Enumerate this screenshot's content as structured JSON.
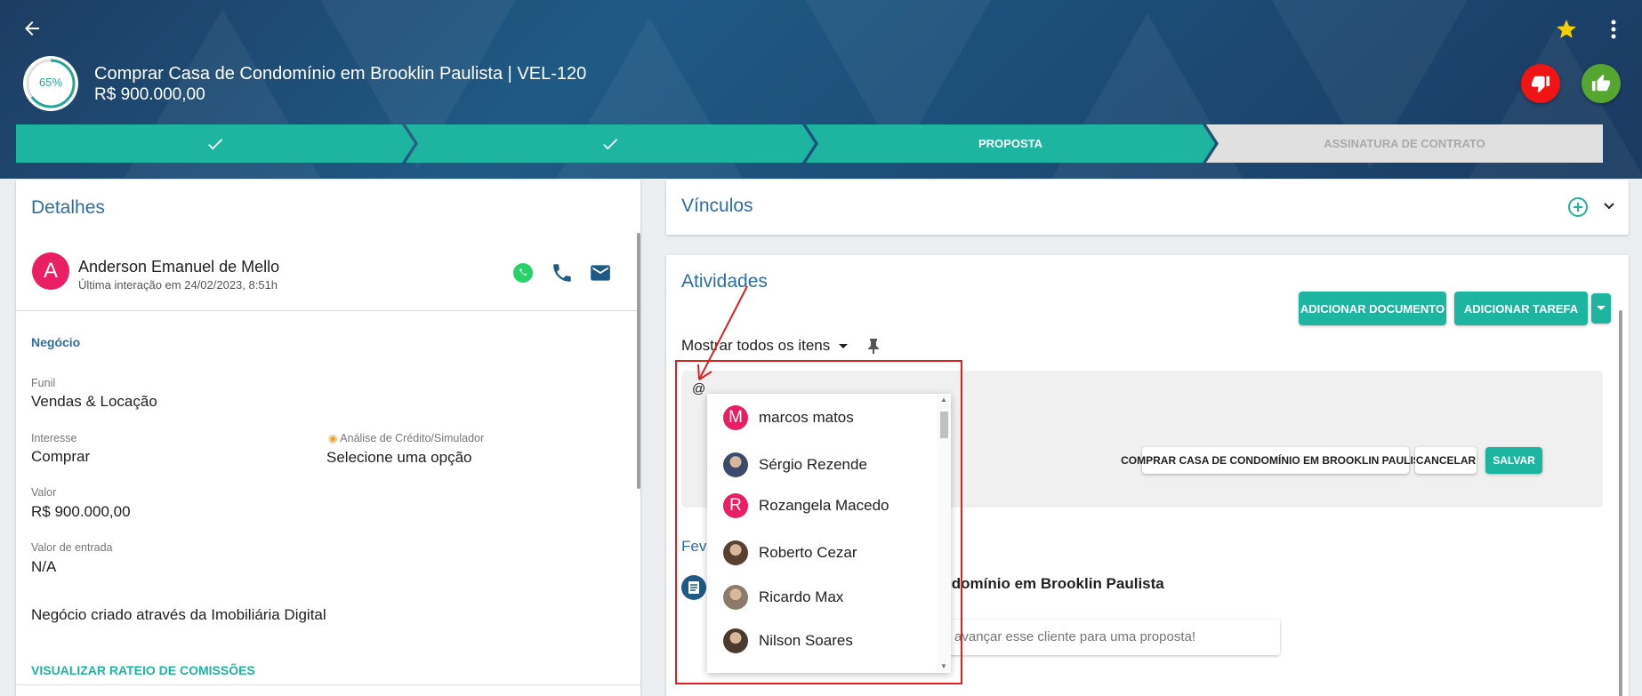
{
  "header": {
    "progress_label": "65%",
    "progress_value": 0.65,
    "deal_title": "Comprar Casa de Condomínio em Brooklin Paulista | VEL-120",
    "deal_value": "R$ 900.000,00",
    "favorite_icon": "star-icon",
    "more_icon": "more-vert-icon",
    "back_icon": "arrow-back-icon",
    "lose_icon": "thumb-down-icon",
    "win_icon": "thumb-up-icon",
    "colors": {
      "lose": "#f01414",
      "win": "#55a630",
      "accent": "#1db5a0"
    }
  },
  "stages": [
    {
      "label": "",
      "status": "done",
      "icon": "check-icon"
    },
    {
      "label": "",
      "status": "done",
      "icon": "check-icon"
    },
    {
      "label": "PROPOSTA",
      "status": "current"
    },
    {
      "label": "ASSINATURA DE CONTRATO",
      "status": "future"
    }
  ],
  "details": {
    "title": "Detalhes",
    "contact": {
      "initial": "A",
      "name": "Anderson Emanuel de Mello",
      "last_interaction": "Última interação em 24/02/2023, 8:51h"
    },
    "section": "Negócio",
    "funil_label": "Funil",
    "funil_value": "Vendas & Locação",
    "interesse_label": "Interesse",
    "interesse_value": "Comprar",
    "credito_label": "Análise de Crédito/Simulador",
    "credito_value": "Selecione uma opção",
    "valor_label": "Valor",
    "valor_value": "R$ 900.000,00",
    "entrada_label": "Valor de entrada",
    "entrada_value": "N/A",
    "origin_text": "Negócio criado através da Imobiliária Digital",
    "commission_link": "VISUALIZAR RATEIO DE COMISSÕES"
  },
  "vinculos": {
    "title": "Vínculos"
  },
  "atividades": {
    "title": "Atividades",
    "add_document": "ADICIONAR DOCUMENTO",
    "add_task": "ADICIONAR TAREFA",
    "filter": "Mostrar todos os itens",
    "editor_text": "@",
    "deal_chip": "COMPRAR CASA DE CONDOMÍNIO EM BROOKLIN PAULISTA",
    "cancel": "CANCELAR",
    "save": "SALVAR",
    "feed_date": "Fev",
    "feed_title": "ondomínio em Brooklin Paulista",
    "feed_message": "os avançar esse cliente para uma proposta!"
  },
  "mentions": [
    {
      "name": "marcos matos",
      "initial": "M",
      "color": "#e91e63",
      "photo": false
    },
    {
      "name": "Sérgio Rezende",
      "initial": "",
      "color": "#3c4a6b",
      "photo": true
    },
    {
      "name": "Rozangela Macedo",
      "initial": "R",
      "color": "#e91e63",
      "photo": false
    },
    {
      "name": "Roberto Cezar",
      "initial": "",
      "color": "#5a4030",
      "photo": true
    },
    {
      "name": "Ricardo Max",
      "initial": "",
      "color": "#8c7a6a",
      "photo": true
    },
    {
      "name": "Nilson Soares",
      "initial": "",
      "color": "#4a3a30",
      "photo": true
    }
  ]
}
